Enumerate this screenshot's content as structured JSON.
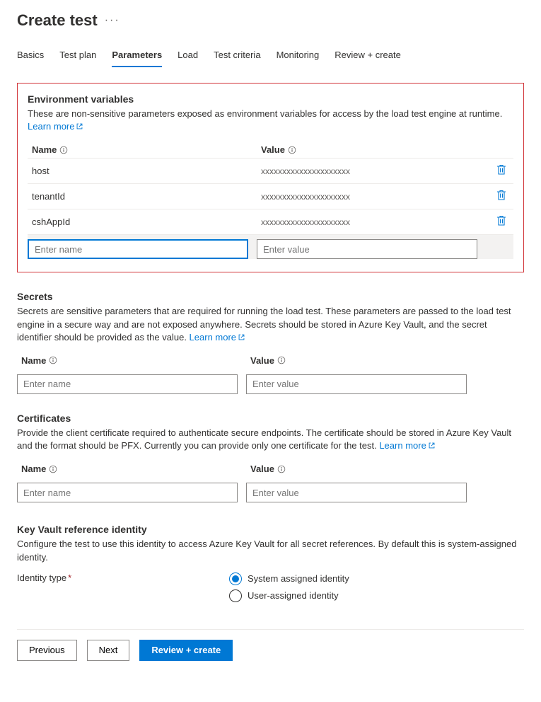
{
  "header": {
    "title": "Create test"
  },
  "tabs": {
    "items": [
      {
        "label": "Basics"
      },
      {
        "label": "Test plan"
      },
      {
        "label": "Parameters"
      },
      {
        "label": "Load"
      },
      {
        "label": "Test criteria"
      },
      {
        "label": "Monitoring"
      },
      {
        "label": "Review + create"
      }
    ],
    "active_index": 2
  },
  "env": {
    "title": "Environment variables",
    "desc_prefix": "These are non-sensitive parameters exposed as environment variables for access by the load test engine at runtime. ",
    "learn_more": "Learn more",
    "columns": {
      "name": "Name",
      "value": "Value"
    },
    "rows": [
      {
        "name": "host",
        "value": "xxxxxxxxxxxxxxxxxxxxx"
      },
      {
        "name": "tenantId",
        "value": "xxxxxxxxxxxxxxxxxxxxx"
      },
      {
        "name": "cshAppId",
        "value": "xxxxxxxxxxxxxxxxxxxxx"
      }
    ],
    "new_row": {
      "name_ph": "Enter name",
      "value_ph": "Enter value"
    }
  },
  "secrets": {
    "title": "Secrets",
    "desc_prefix": "Secrets are sensitive parameters that are required for running the load test. These parameters are passed to the load test engine in a secure way and are not exposed anywhere. Secrets should be stored in Azure Key Vault, and the secret identifier should be provided as the value. ",
    "learn_more": "Learn more",
    "columns": {
      "name": "Name",
      "value": "Value"
    },
    "new_row": {
      "name_ph": "Enter name",
      "value_ph": "Enter value"
    }
  },
  "certs": {
    "title": "Certificates",
    "desc_prefix": "Provide the client certificate required to authenticate secure endpoints. The certificate should be stored in Azure Key Vault and the format should be PFX. Currently you can provide only one certificate for the test. ",
    "learn_more": "Learn more",
    "columns": {
      "name": "Name",
      "value": "Value"
    },
    "new_row": {
      "name_ph": "Enter name",
      "value_ph": "Enter value"
    }
  },
  "kv": {
    "title": "Key Vault reference identity",
    "desc": "Configure the test to use this identity to access Azure Key Vault for all secret references. By default this is system-assigned identity.",
    "label": "Identity type",
    "options": [
      {
        "label": "System assigned identity",
        "checked": true
      },
      {
        "label": "User-assigned identity",
        "checked": false
      }
    ]
  },
  "footer": {
    "previous": "Previous",
    "next": "Next",
    "review": "Review + create"
  }
}
